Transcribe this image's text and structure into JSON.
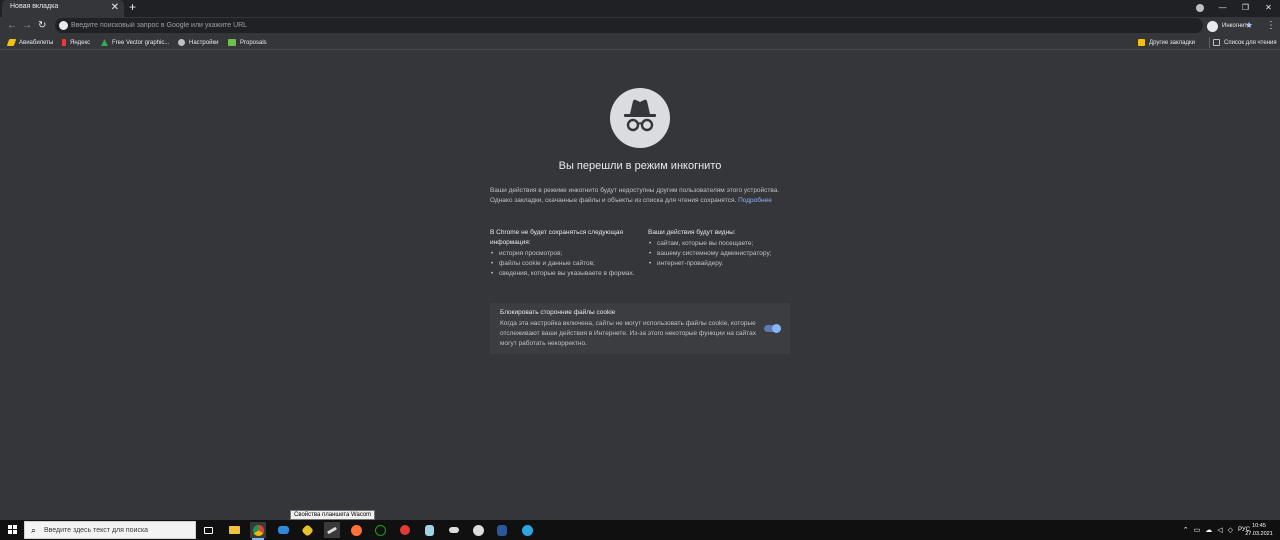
{
  "tab": {
    "title": "Новая вкладка",
    "close": "✕",
    "new_tab": "+"
  },
  "window_controls": {
    "minimize": "—",
    "maximize": "❐",
    "close": "✕"
  },
  "toolbar": {
    "back": "←",
    "forward": "→",
    "reload": "↻",
    "omnibox_placeholder": "Введите поисковый запрос в Google или укажите URL",
    "star": "★",
    "profile_label": "Инкогнито",
    "menu": "⋮"
  },
  "bookmarks": {
    "items": [
      {
        "label": "Авиабилеты",
        "icon": "plane-icon",
        "color": "#f4c20d"
      },
      {
        "label": "Яндекс",
        "icon": "yandex-icon",
        "color": "#ff3333"
      },
      {
        "label": "Free Vector graphic...",
        "icon": "vector-icon",
        "color": "#34a853"
      },
      {
        "label": "Настройки",
        "icon": "gear-icon",
        "color": "#bdc1c6"
      },
      {
        "label": "Proposals",
        "icon": "proposals-icon",
        "color": "#6cc24a"
      }
    ],
    "other_bookmarks": "Другие закладки",
    "reading_list": "Список для чтения"
  },
  "content": {
    "heading": "Вы перешли в режим инкогнито",
    "intro": "Ваши действия в режиме инкогнито будут недоступны другим пользователям этого устройства. Однако закладки, скачанные файлы и объекты из списка для чтения сохранятся.",
    "learn_more": "Подробнее",
    "not_saved_title": "В Chrome не будет сохраняться следующая информация:",
    "not_saved_items": [
      "история просмотров;",
      "файлы cookie и данные сайтов;",
      "сведения, которые вы указываете в формах."
    ],
    "visible_title": "Ваши действия будут видны:",
    "visible_items": [
      "сайтам, которые вы посещаете;",
      "вашему системному администратору;",
      "интернет-провайдеру."
    ],
    "cookie_title": "Блокировать сторонние файлы cookie",
    "cookie_desc": "Когда эта настройка включена, сайты не могут использовать файлы cookie, которые отслеживают ваши действия в Интернете. Из-за этого некоторые функции на сайтах могут работать некорректно.",
    "cookie_toggle_on": true
  },
  "tooltip": "Свойства планшета Wacom",
  "taskbar": {
    "search_placeholder": "Введите здесь текст для поиска",
    "apps": [
      {
        "name": "task-view-icon",
        "color": "#ffffff"
      },
      {
        "name": "file-explorer-icon",
        "color": "#f3c13a"
      },
      {
        "name": "chrome-icon",
        "color": "#4caf50"
      },
      {
        "name": "mail-icon",
        "color": "#2f89d9"
      },
      {
        "name": "wacom-icon",
        "color": "#dddddd"
      },
      {
        "name": "app-icon",
        "color": "#e6c229"
      },
      {
        "name": "firefox-icon",
        "color": "#ff7139"
      },
      {
        "name": "upwork-icon",
        "color": "#14a800"
      },
      {
        "name": "red-app-icon",
        "color": "#e53935"
      },
      {
        "name": "notes-icon",
        "color": "#9fd3e6"
      },
      {
        "name": "tool-icon",
        "color": "#dddddd"
      },
      {
        "name": "clock-app-icon",
        "color": "#dddddd"
      },
      {
        "name": "word-icon",
        "color": "#2b579a"
      },
      {
        "name": "telegram-icon",
        "color": "#2ca5e0"
      }
    ],
    "tray_lang": "РУС",
    "time": "10:45",
    "date": "27.03.2021"
  }
}
